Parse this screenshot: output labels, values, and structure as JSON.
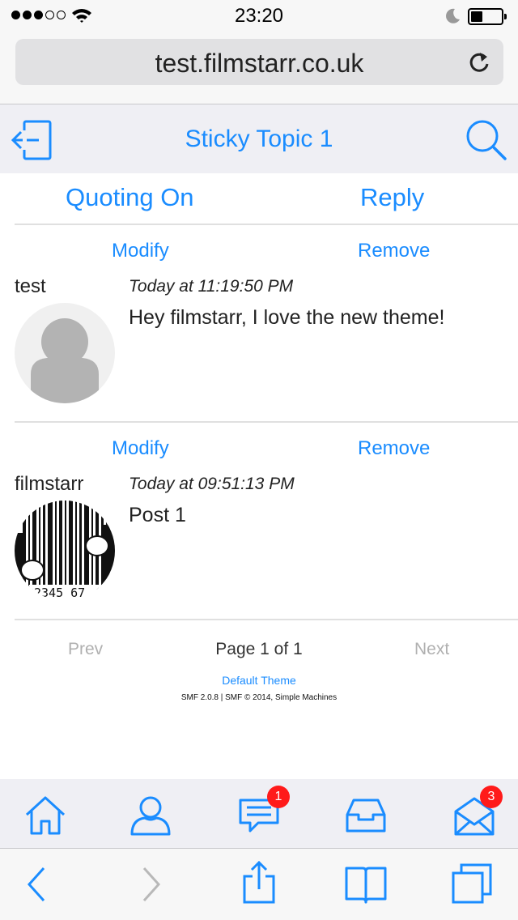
{
  "status_bar": {
    "time": "23:20",
    "signal_bars": 3,
    "signal_total": 5
  },
  "browser": {
    "url": "test.filmstarr.co.uk"
  },
  "header": {
    "title": "Sticky Topic 1"
  },
  "actions": {
    "quoting": "Quoting On",
    "reply": "Reply"
  },
  "posts": [
    {
      "modify": "Modify",
      "remove": "Remove",
      "author": "test",
      "time": "Today at 11:19:50 PM",
      "message": "Hey filmstarr, I love the new theme!"
    },
    {
      "modify": "Modify",
      "remove": "Remove",
      "author": "filmstarr",
      "time": "Today at 09:51:13 PM",
      "message": "Post 1"
    }
  ],
  "pagination": {
    "prev": "Prev",
    "page_info": "Page 1 of 1",
    "next": "Next"
  },
  "footer": {
    "theme": "Default Theme",
    "copyright": "SMF 2.0.8 | SMF © 2014, Simple Machines"
  },
  "tab_bar": {
    "items": [
      {
        "icon": "home-icon"
      },
      {
        "icon": "profile-icon"
      },
      {
        "icon": "messages-icon",
        "badge": "1"
      },
      {
        "icon": "inbox-icon"
      },
      {
        "icon": "mail-icon",
        "badge": "3"
      }
    ]
  },
  "browser_toolbar": {
    "icons": [
      "back-icon",
      "forward-icon",
      "share-icon",
      "bookmarks-icon",
      "tabs-icon"
    ]
  },
  "colors": {
    "accent": "#1a8cff",
    "badge": "#ff1a1a",
    "divider": "#e0e0e0",
    "header_bg": "#efeff4"
  }
}
